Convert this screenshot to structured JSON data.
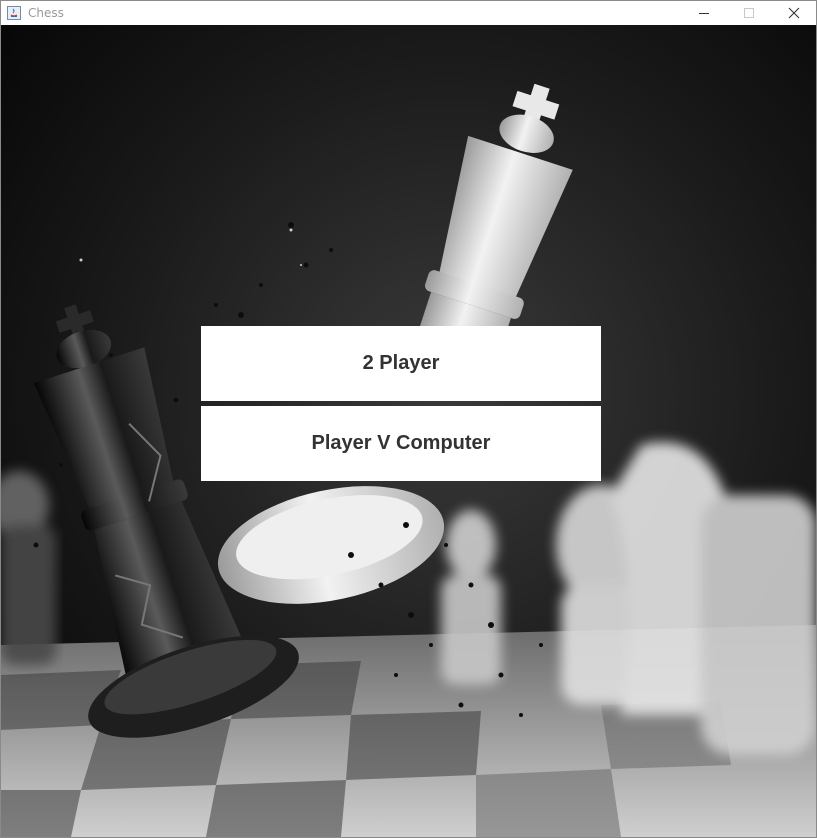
{
  "window": {
    "title": "Chess",
    "icon": "java-app-icon"
  },
  "menu": {
    "two_player_label": "2 Player",
    "vs_computer_label": "Player V Computer"
  },
  "background": {
    "description_icon": "chess-king-smash-image"
  },
  "colors": {
    "button_bg": "#ffffff",
    "button_text": "#333333",
    "title_text": "#999999"
  }
}
